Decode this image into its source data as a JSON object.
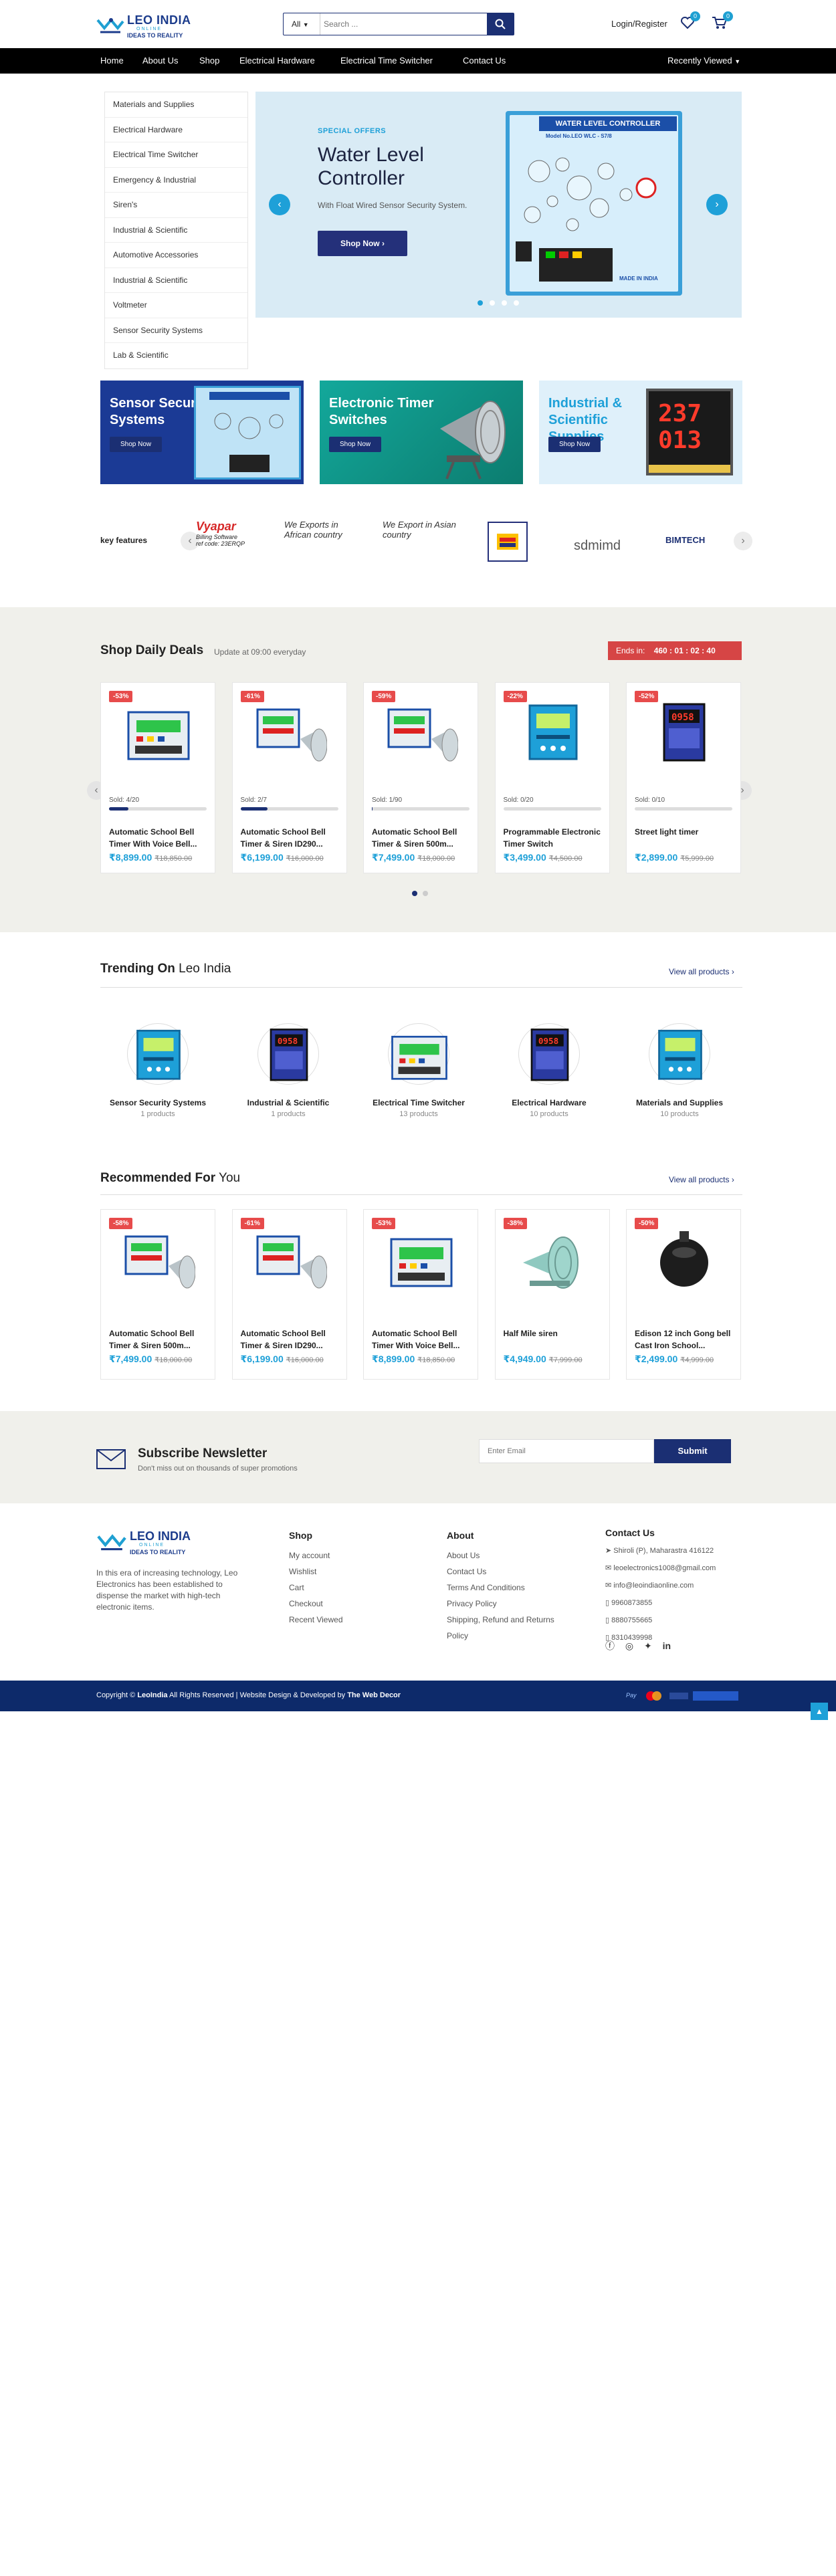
{
  "header": {
    "logo_main": "LEO INDIA",
    "logo_sub": "ONLINE",
    "logo_tag": "IDEAS TO REALITY",
    "search_category": "All",
    "search_placeholder": "Search ...",
    "login_label": "Login/Register",
    "wishlist_count": "0",
    "cart_count": "0"
  },
  "nav": {
    "items": [
      "Home",
      "About Us",
      "Shop",
      "Electrical Hardware",
      "Electrical Time Switcher",
      "Contact Us"
    ],
    "recent": "Recently Viewed"
  },
  "sidebar": {
    "items": [
      "Materials and Supplies",
      "Electrical Hardware",
      "Electrical Time Switcher",
      "Emergency & Industrial",
      "Siren's",
      "Industrial & Scientific",
      "Automotive Accessories",
      "Industrial & Scientific",
      "Voltmeter",
      "Sensor Security Systems",
      "Lab & Scientific"
    ]
  },
  "hero": {
    "eyebrow": "SPECIAL OFFERS",
    "title_line1": "Water Level",
    "title_line2": "Controller",
    "desc": "With Float Wired Sensor Security System.",
    "button": "Shop Now",
    "device_title": "WATER LEVEL CONTROLLER",
    "device_model": "Model No.LEO WLC - S7/8",
    "device_made": "MADE IN INDIA",
    "slides": 4,
    "active_slide": 1
  },
  "promos": [
    {
      "title": "Sensor Security Systems",
      "button": "Shop Now",
      "bg": "#1b3a95"
    },
    {
      "title": "Electronic Timer Switches",
      "button": "Shop Now",
      "bg": "#17a095"
    },
    {
      "title": "Industrial & Scientific Supplies",
      "button": "Shop Now",
      "bg": "#dff0fa"
    }
  ],
  "brands": {
    "label": "key features",
    "vyapar": "Vyapar",
    "vyapar_sub": "Billing Software",
    "vyapar_ref": "ref code: 23ERQP",
    "africa": "We Exports in African country",
    "asia": "We Export in Asian country",
    "sdm": "sdmimd",
    "bimtech": "BIMTECH"
  },
  "deals": {
    "title": "Shop Daily Deals",
    "update": "Update at 09:00 everyday",
    "ends_label": "Ends in:",
    "countdown": "460 : 01 : 02 : 40",
    "products": [
      {
        "discount": "-53%",
        "sold": "Sold: 4/20",
        "sold_pct": 20,
        "title": "Automatic School Bell Timer With Voice Bell...",
        "price": "₹8,899.00",
        "old": "₹18,850.00"
      },
      {
        "discount": "-61%",
        "sold": "Sold: 2/7",
        "sold_pct": 28,
        "title": "Automatic School Bell Timer & Siren ID290...",
        "price": "₹6,199.00",
        "old": "₹16,000.00"
      },
      {
        "discount": "-59%",
        "sold": "Sold: 1/90",
        "sold_pct": 1,
        "title": "Automatic School Bell Timer & Siren 500m...",
        "price": "₹7,499.00",
        "old": "₹18,000.00"
      },
      {
        "discount": "-22%",
        "sold": "Sold: 0/20",
        "sold_pct": 0,
        "title": "Programmable Electronic Timer Switch",
        "price": "₹3,499.00",
        "old": "₹4,500.00"
      },
      {
        "discount": "-52%",
        "sold": "Sold: 0/10",
        "sold_pct": 0,
        "title": "Street light timer",
        "price": "₹2,899.00",
        "old": "₹5,999.00"
      }
    ]
  },
  "trending": {
    "title_bold": "Trending On",
    "title_rest": "Leo India",
    "view_all": "View all products ›",
    "cats": [
      {
        "name": "Sensor Security Systems",
        "count": "1 products"
      },
      {
        "name": "Industrial & Scientific",
        "count": "1 products"
      },
      {
        "name": "Electrical Time Switcher",
        "count": "13 products"
      },
      {
        "name": "Electrical Hardware",
        "count": "10 products"
      },
      {
        "name": "Materials and Supplies",
        "count": "10 products"
      }
    ]
  },
  "recommended": {
    "title_bold": "Recommended For",
    "title_rest": "You",
    "view_all": "View all products ›",
    "products": [
      {
        "discount": "-58%",
        "title": "Automatic School Bell Timer & Siren 500m...",
        "price": "₹7,499.00",
        "old": "₹18,000.00"
      },
      {
        "discount": "-61%",
        "title": "Automatic School Bell Timer & Siren ID290...",
        "price": "₹6,199.00",
        "old": "₹16,000.00"
      },
      {
        "discount": "-53%",
        "title": "Automatic School Bell Timer With Voice Bell...",
        "price": "₹8,899.00",
        "old": "₹18,850.00"
      },
      {
        "discount": "-38%",
        "title": "Half Mile siren",
        "price": "₹4,949.00",
        "old": "₹7,999.00"
      },
      {
        "discount": "-50%",
        "title": "Edison 12 inch Gong bell Cast Iron School...",
        "price": "₹2,499.00",
        "old": "₹4,999.00"
      }
    ]
  },
  "newsletter": {
    "title": "Subscribe Newsletter",
    "sub": "Don't miss out on thousands of super promotions",
    "placeholder": "Enter Email",
    "button": "Submit"
  },
  "footer": {
    "about_text": "In this era of increasing technology, Leo Electronics has been established to dispense the market with high-tech electronic items.",
    "shop_title": "Shop",
    "shop_links": [
      "My account",
      "Wishlist",
      "Cart",
      "Checkout",
      "Recent Viewed"
    ],
    "about_title": "About",
    "about_links": [
      "About Us",
      "Contact Us",
      "Terms And Conditions",
      "Privacy Policy",
      "Shipping, Refund and Returns",
      "Policy"
    ],
    "contact_title": "Contact Us",
    "address": "Shiroli (P), Maharastra 416122",
    "email1": "leoelectronics1008@gmail.com",
    "email2": "info@leoindiaonline.com",
    "phone1": "9960873855",
    "phone2": "8880755665",
    "phone3": "8310439998",
    "copyright_pre": "Copyright ©",
    "copyright_brand": "LeoIndia",
    "copyright_mid": "All Rights Reserved | Website Design & Developed by",
    "copyright_dev": "The Web Decor"
  }
}
